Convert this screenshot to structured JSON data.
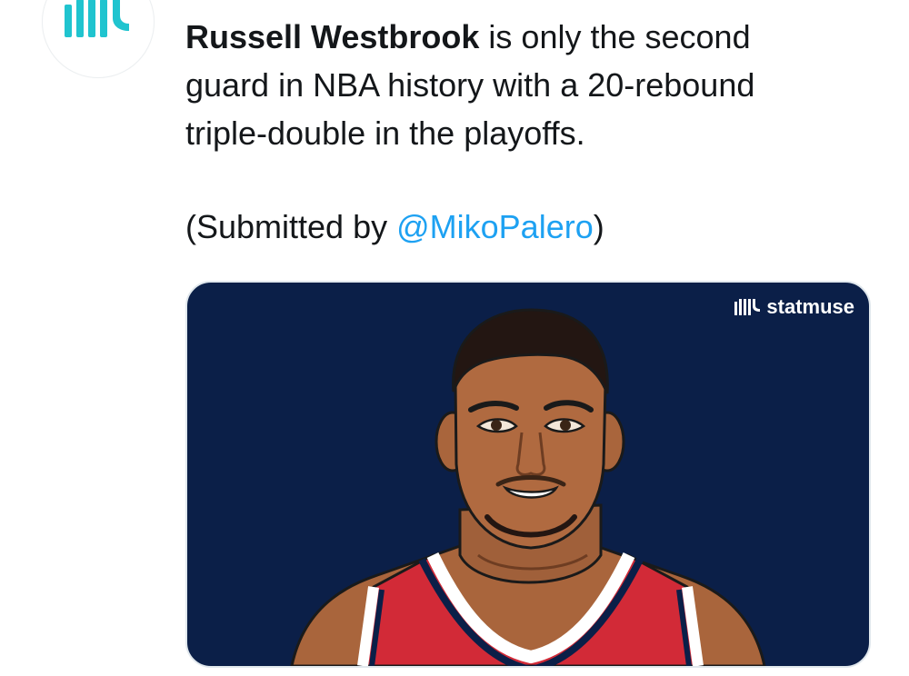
{
  "account": {
    "avatar_icon": "statmuse-logo-icon",
    "brand_color": "#20c4cf"
  },
  "tweet": {
    "bold_name": "Russell Westbrook",
    "text_rest": " is only the second guard in NBA history with a 20-rebound triple-double in the playoffs.",
    "submitted_prefix": "(Submitted by ",
    "submitted_mention": "@MikoPalero",
    "submitted_suffix": ")",
    "mention_color": "#1da1f2"
  },
  "media": {
    "watermark_text": "statmuse",
    "watermark_icon": "statmuse-logo-icon",
    "background_color": "#0b1f48",
    "illustration": "player-portrait-illustration"
  }
}
